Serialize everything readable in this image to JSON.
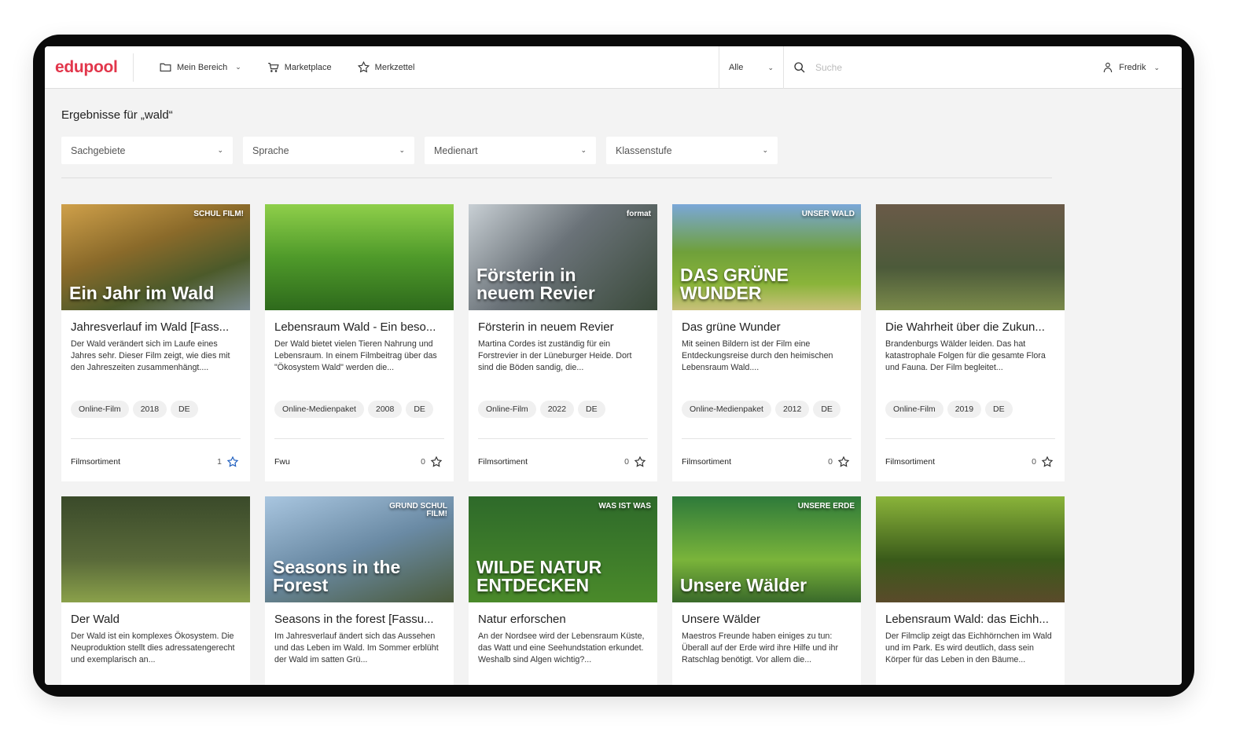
{
  "header": {
    "logo": "edupool",
    "nav": [
      {
        "label": "Mein Bereich",
        "icon": "folder-icon"
      },
      {
        "label": "Marketplace",
        "icon": "cart-icon"
      },
      {
        "label": "Merkzettel",
        "icon": "star-icon"
      }
    ],
    "scope": "Alle",
    "search_placeholder": "Suche",
    "user": "Fredrik"
  },
  "results_title": "Ergebnisse für „wald“",
  "filters": [
    "Sachgebiete",
    "Sprache",
    "Medienart",
    "Klassenstufe"
  ],
  "accent": "#e2364b",
  "fav_active": "#1f5fbf",
  "cards": [
    {
      "thumb_text": "Ein Jahr im Wald",
      "badge": "SCHUL FILM!",
      "title": "Jahresverlauf im Wald [Fass...",
      "desc": "Der Wald verändert sich im Laufe eines Jahres sehr. Dieser Film zeigt, wie dies mit den Jahreszeiten zusammenhängt....",
      "tags": [
        "Online-Film",
        "2018",
        "DE"
      ],
      "source": "Filmsortiment",
      "favs": "1",
      "fav_active": true
    },
    {
      "thumb_text": "",
      "badge": "",
      "title": "Lebensraum Wald - Ein beso...",
      "desc": "Der Wald bietet vielen Tieren Nahrung und Lebensraum. In einem Filmbeitrag über das \"Ökosystem Wald\" werden die...",
      "tags": [
        "Online-Medienpaket",
        "2008",
        "DE"
      ],
      "source": "Fwu",
      "favs": "0",
      "fav_active": false
    },
    {
      "thumb_text": "Försterin in neuem Revier",
      "badge": "format",
      "title": "Försterin in neuem Revier",
      "desc": "Martina Cordes ist zuständig für ein Forstrevier in der Lüneburger Heide. Dort sind die Böden sandig, die...",
      "tags": [
        "Online-Film",
        "2022",
        "DE"
      ],
      "source": "Filmsortiment",
      "favs": "0",
      "fav_active": false
    },
    {
      "thumb_text": "DAS GRÜNE WUNDER",
      "badge": "UNSER WALD",
      "title": "Das grüne Wunder",
      "desc": "Mit seinen Bildern ist der Film eine Entdeckungsreise durch den heimischen Lebensraum Wald....",
      "tags": [
        "Online-Medienpaket",
        "2012",
        "DE"
      ],
      "source": "Filmsortiment",
      "favs": "0",
      "fav_active": false
    },
    {
      "thumb_text": "",
      "badge": "",
      "title": "Die Wahrheit über die Zukun...",
      "desc": "Brandenburgs Wälder leiden. Das hat katastrophale Folgen für die gesamte Flora und Fauna. Der Film begleitet...",
      "tags": [
        "Online-Film",
        "2019",
        "DE"
      ],
      "source": "Filmsortiment",
      "favs": "0",
      "fav_active": false
    },
    {
      "thumb_text": "",
      "badge": "",
      "title": "Der Wald",
      "desc": "Der Wald ist ein komplexes Ökosystem. Die Neuproduktion stellt dies adressatengerecht und exemplarisch an...",
      "tags": [],
      "source": "",
      "favs": "",
      "fav_active": false
    },
    {
      "thumb_text": "Seasons in the Forest",
      "badge": "GRUND SCHUL FILM!",
      "title": "Seasons in the forest [Fassu...",
      "desc": "Im Jahresverlauf ändert sich das Aussehen und das Leben im Wald. Im Sommer erblüht der Wald im satten Grü...",
      "tags": [],
      "source": "",
      "favs": "",
      "fav_active": false
    },
    {
      "thumb_text": "WILDE NATUR ENTDECKEN",
      "badge": "WAS IST WAS",
      "title": "Natur erforschen",
      "desc": "An der Nordsee wird der Lebensraum Küste, das Watt und eine Seehundstation erkundet. Weshalb sind Algen wichtig?...",
      "tags": [],
      "source": "",
      "favs": "",
      "fav_active": false
    },
    {
      "thumb_text": "Unsere Wälder",
      "badge": "UNSERE ERDE",
      "title": "Unsere Wälder",
      "desc": "Maestros Freunde haben einiges zu tun: Überall auf der Erde wird ihre Hilfe und ihr Ratschlag benötigt. Vor allem die...",
      "tags": [],
      "source": "",
      "favs": "",
      "fav_active": false
    },
    {
      "thumb_text": "",
      "badge": "",
      "title": "Lebensraum Wald: das Eichh...",
      "desc": "Der Filmclip zeigt das Eichhörnchen im Wald und im Park. Es wird deutlich, dass sein Körper für das Leben in den Bäume...",
      "tags": [],
      "source": "",
      "favs": "",
      "fav_active": false
    }
  ]
}
